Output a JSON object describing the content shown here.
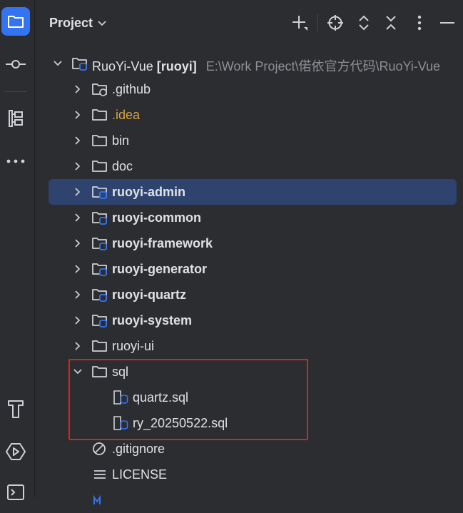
{
  "panel": {
    "title": "Project"
  },
  "root": {
    "name": "RuoYi-Vue",
    "module": "[ruoyi]",
    "path": "E:\\Work Project\\偌依官方代码\\RuoYi-Vue"
  },
  "items": [
    {
      "label": ".github",
      "kind": "folder",
      "badge": "github",
      "style": "normal"
    },
    {
      "label": ".idea",
      "kind": "folder",
      "style": "orange"
    },
    {
      "label": "bin",
      "kind": "folder",
      "style": "normal"
    },
    {
      "label": "doc",
      "kind": "folder",
      "style": "normal"
    },
    {
      "label": "ruoyi-admin",
      "kind": "module",
      "style": "bold",
      "selected": true
    },
    {
      "label": "ruoyi-common",
      "kind": "module",
      "style": "bold"
    },
    {
      "label": "ruoyi-framework",
      "kind": "module",
      "style": "bold"
    },
    {
      "label": "ruoyi-generator",
      "kind": "module",
      "style": "bold"
    },
    {
      "label": "ruoyi-quartz",
      "kind": "module",
      "style": "bold"
    },
    {
      "label": "ruoyi-system",
      "kind": "module",
      "style": "bold"
    },
    {
      "label": "ruoyi-ui",
      "kind": "folder",
      "style": "normal"
    },
    {
      "label": "sql",
      "kind": "folder",
      "style": "normal",
      "expanded": true
    },
    {
      "label": "quartz.sql",
      "kind": "sql-file",
      "style": "normal"
    },
    {
      "label": "ry_20250522.sql",
      "kind": "sql-file",
      "style": "normal"
    },
    {
      "label": ".gitignore",
      "kind": "gitignore",
      "style": "normal"
    },
    {
      "label": "LICENSE",
      "kind": "text-file",
      "style": "normal"
    }
  ],
  "colors": {
    "accent": "#3574f0",
    "selection": "#2e436e",
    "highlight_box": "#e0211c",
    "folder_dot": "#3574f0"
  }
}
